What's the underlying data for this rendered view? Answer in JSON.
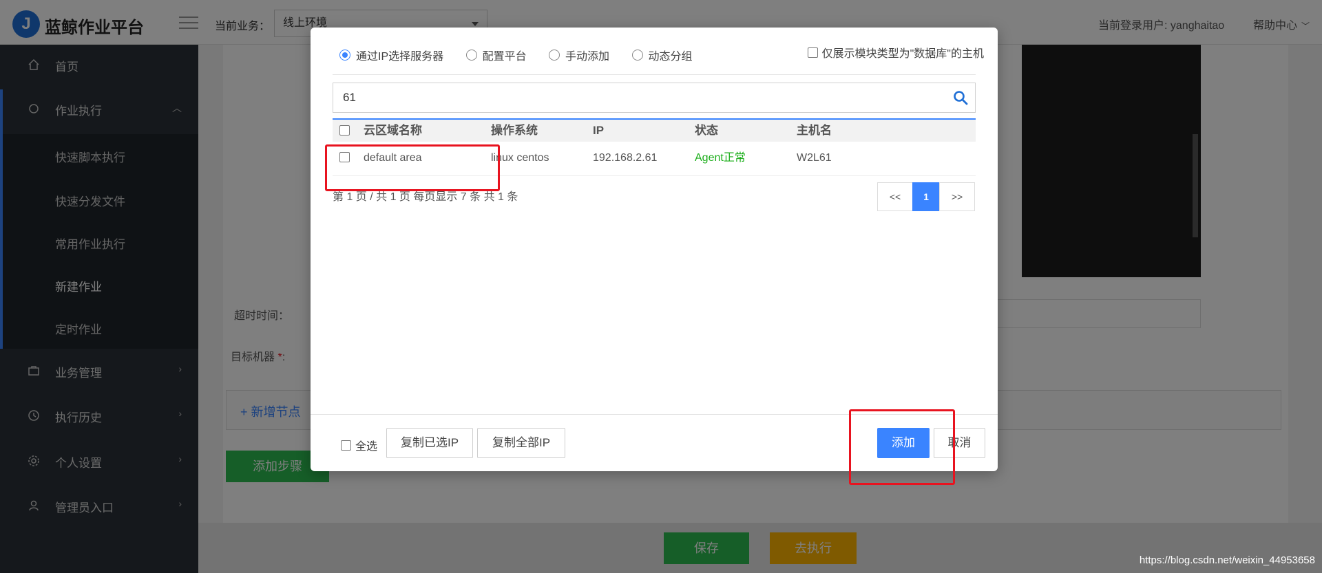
{
  "header": {
    "logo_letter": "J",
    "app_title": "蓝鲸作业平台",
    "business_label": "当前业务：",
    "business_value": "线上环境",
    "login_user": "当前登录用户: yanghaitao",
    "help_center": "帮助中心"
  },
  "sidebar": {
    "items": [
      {
        "label": "首页"
      },
      {
        "label": "作业执行"
      },
      {
        "label": "业务管理"
      },
      {
        "label": "执行历史"
      },
      {
        "label": "个人设置"
      },
      {
        "label": "管理员入口"
      }
    ],
    "sub_items": [
      {
        "label": "快速脚本执行"
      },
      {
        "label": "快速分发文件"
      },
      {
        "label": "常用作业执行"
      },
      {
        "label": "新建作业"
      },
      {
        "label": "定时作业"
      }
    ]
  },
  "main": {
    "timeout_label": "超时时间：",
    "target_label": "目标机器",
    "required_mark": "*",
    "target_colon": ":",
    "add_node": "+  新增节点",
    "add_step": "添加步骤",
    "save": "保存",
    "execute": "去执行"
  },
  "dialog": {
    "radios": [
      {
        "label": "通过IP选择服务器",
        "checked": true
      },
      {
        "label": "配置平台",
        "checked": false
      },
      {
        "label": "手动添加",
        "checked": false
      },
      {
        "label": "动态分组",
        "checked": false
      }
    ],
    "db_only_label": "仅展示模块类型为\"数据库\"的主机",
    "search_value": "61",
    "table": {
      "columns": [
        "云区域名称",
        "操作系统",
        "IP",
        "状态",
        "主机名"
      ],
      "rows": [
        {
          "area": "default area",
          "os": "linux centos",
          "ip": "192.168.2.61",
          "status": "Agent正常",
          "host": "W2L61"
        }
      ]
    },
    "pager_info": "第 1 页 / 共 1 页  每页显示 7 条  共 1 条",
    "pager": {
      "prev": "<<",
      "current": "1",
      "next": ">>"
    },
    "select_all": "全选",
    "copy_selected": "复制已选IP",
    "copy_all": "复制全部IP",
    "confirm": "添加",
    "cancel": "取消"
  },
  "watermark": "https://blog.csdn.net/weixin_44953658",
  "colors": {
    "accent": "#3a84ff",
    "success": "#1aad19",
    "annotation": "#e8131f"
  }
}
